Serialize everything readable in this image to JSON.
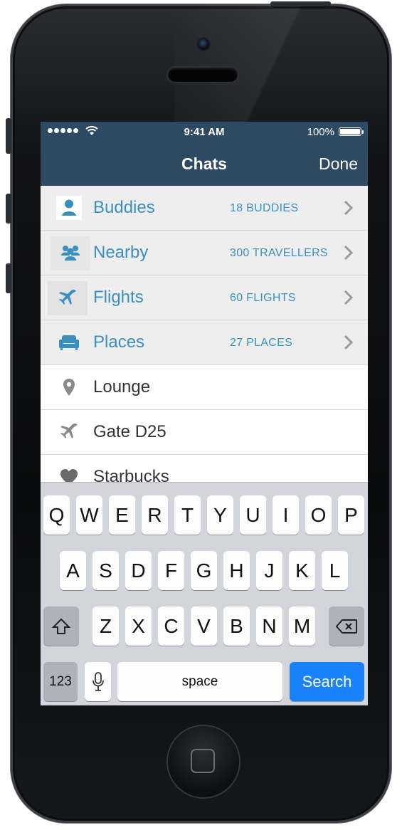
{
  "status_bar": {
    "time": "9:41 AM",
    "battery": "100%"
  },
  "nav": {
    "title": "Chats",
    "done_label": "Done"
  },
  "categories": [
    {
      "name": "Buddies",
      "count": "18 BUDDIES",
      "icon": "person-icon"
    },
    {
      "name": "Nearby",
      "count": "300 TRAVELLERS",
      "icon": "people-group-icon"
    },
    {
      "name": "Flights",
      "count": "60 FLIGHTS",
      "icon": "airplane-icon"
    },
    {
      "name": "Places",
      "count": "27 PLACES",
      "icon": "armchair-icon"
    }
  ],
  "places": [
    {
      "name": "Lounge",
      "icon": "location-pin-icon"
    },
    {
      "name": "Gate D25",
      "icon": "airplane-icon"
    },
    {
      "name": "Starbucks",
      "icon": "heart-icon"
    }
  ],
  "keyboard": {
    "row1": [
      "Q",
      "W",
      "E",
      "R",
      "T",
      "Y",
      "U",
      "I",
      "O",
      "P"
    ],
    "row2": [
      "A",
      "S",
      "D",
      "F",
      "G",
      "H",
      "J",
      "K",
      "L"
    ],
    "row3": [
      "Z",
      "X",
      "C",
      "V",
      "B",
      "N",
      "M"
    ],
    "numbers_label": "123",
    "space_label": "space",
    "search_label": "Search"
  },
  "colors": {
    "nav_bar": "#2e4a63",
    "accent": "#3a8fbf",
    "search_key": "#1a82fb"
  }
}
